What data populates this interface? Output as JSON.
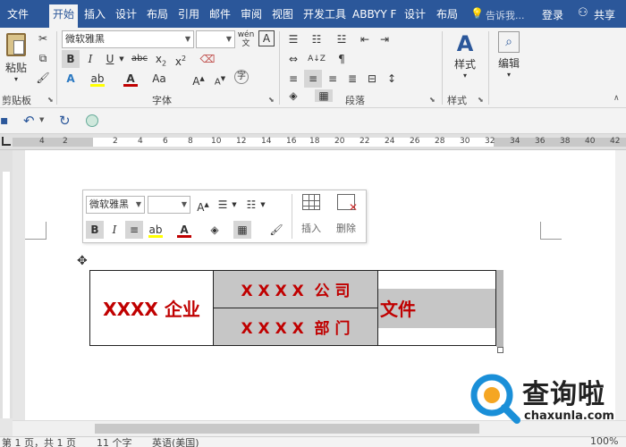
{
  "menu": {
    "tabs": [
      "文件",
      "开始",
      "插入",
      "设计",
      "布局",
      "引用",
      "邮件",
      "审阅",
      "视图",
      "开发工具",
      "ABBYY F",
      "设计",
      "布局"
    ],
    "active_tab": 1,
    "tell_me": "告诉我...",
    "login": "登录",
    "share": "共享"
  },
  "ribbon": {
    "clipboard": {
      "paste": "粘贴",
      "label": "剪贴板"
    },
    "font": {
      "family": "微软雅黑",
      "size": "",
      "wen": "wén",
      "label": "字体"
    },
    "paragraph": {
      "label": "段落"
    },
    "styles": {
      "button": "样式",
      "label": "样式"
    },
    "editing": {
      "button": "编辑"
    }
  },
  "ruler": {
    "numbers": [
      "4",
      "2",
      "2",
      "4",
      "6",
      "8",
      "10",
      "12",
      "14",
      "16",
      "18",
      "20",
      "22",
      "24",
      "26",
      "28",
      "30",
      "32",
      "34",
      "36",
      "38",
      "40",
      "42"
    ]
  },
  "mini_toolbar": {
    "font": "微软雅黑",
    "size": "",
    "insert": "插入",
    "delete": "删除"
  },
  "table": {
    "left_cell": "XXXX 企业",
    "mid_top": "X X X X  公 司",
    "mid_bottom": "X X X X  部 门",
    "right_cell": "文件"
  },
  "status": {
    "page": "第 1 页，共 1 页",
    "words": "11 个字",
    "lang": "英语(美国)",
    "zoom": "100%"
  },
  "watermark": {
    "name": "查询啦",
    "url": "chaxunla.com"
  },
  "colors": {
    "brand_blue": "#2b579a",
    "table_text_red": "#c00000",
    "cell_highlight": "#c6c6c6"
  }
}
